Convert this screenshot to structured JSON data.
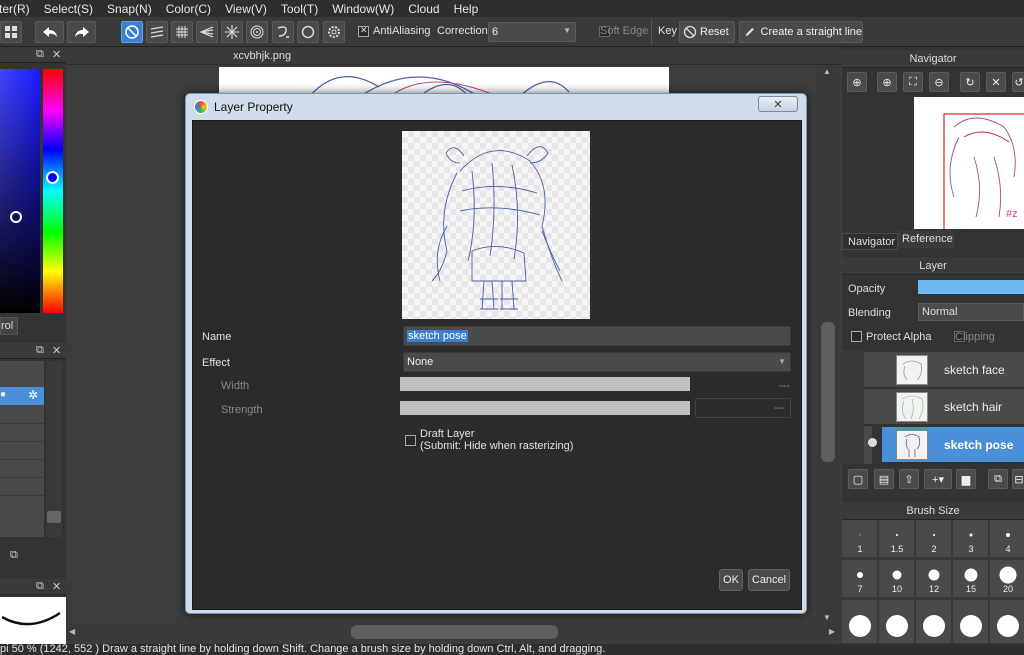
{
  "menu": [
    "ter(R)",
    "Select(S)",
    "Snap(N)",
    "Color(C)",
    "View(V)",
    "Tool(T)",
    "Window(W)",
    "Cloud",
    "Help"
  ],
  "toolbar": {
    "antialiasing_label": "AntiAliasing",
    "correction_label": "Correction",
    "correction_value": "6",
    "soft_edge_label": "Soft Edge",
    "key_label": "Key",
    "reset_label": "Reset",
    "straight_line_label": "Create a straight line"
  },
  "left_panel": {
    "control_label": "rol"
  },
  "canvas": {
    "tab_title": "xcvbhjk.png"
  },
  "navigator": {
    "title": "Navigator",
    "tabs": [
      "Navigator",
      "Reference"
    ]
  },
  "layer_panel": {
    "title": "Layer",
    "opacity_label": "Opacity",
    "blending_label": "Blending",
    "blending_value": "Normal",
    "protect_alpha_label": "Protect Alpha",
    "clipping_label": "Clipping",
    "layers": [
      {
        "name": "sketch face",
        "active": false
      },
      {
        "name": "sketch hair",
        "active": false
      },
      {
        "name": "sketch pose",
        "active": true
      }
    ]
  },
  "brush_size": {
    "title": "Brush Size",
    "sizes": [
      "1",
      "1.5",
      "2",
      "3",
      "4",
      "7",
      "10",
      "12",
      "15",
      "20"
    ]
  },
  "status_bar": {
    "text": "pi  50 %   (1242, 552 )   Draw a straight line by holding down Shift. Change a brush size by holding down Ctrl, Alt, and dragging."
  },
  "dialog": {
    "title": "Layer Property",
    "close_label": "✕",
    "name_label": "Name",
    "name_value": "sketch pose",
    "effect_label": "Effect",
    "effect_value": "None",
    "width_label": "Width",
    "width_value": "---",
    "strength_label": "Strength",
    "strength_value": "---",
    "draft_layer_label": "Draft Layer",
    "draft_layer_note": "(Submit: Hide when rasterizing)",
    "ok_label": "OK",
    "cancel_label": "Cancel"
  },
  "colors": {
    "accent": "#3b7fd0",
    "active_layer": "#4a90d9",
    "dialog_frame": "#cfdcec",
    "sketch_line": "#4a5fa8"
  }
}
